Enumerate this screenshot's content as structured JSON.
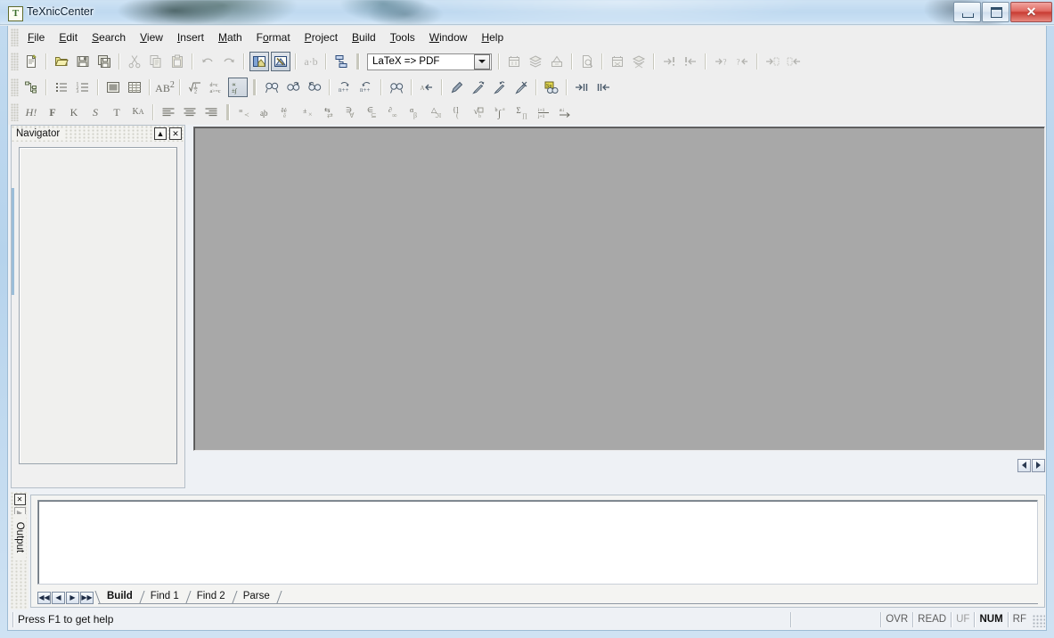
{
  "window": {
    "title": "TeXnicCenter",
    "app_icon": "T",
    "minimize_label": "Minimize",
    "maximize_label": "Maximize",
    "close_label": "Close",
    "close_glyph": "✕"
  },
  "menubar": {
    "items": [
      {
        "label": "File",
        "accel": "F"
      },
      {
        "label": "Edit",
        "accel": "E"
      },
      {
        "label": "Search",
        "accel": "S"
      },
      {
        "label": "View",
        "accel": "V"
      },
      {
        "label": "Insert",
        "accel": "I"
      },
      {
        "label": "Math",
        "accel": "M"
      },
      {
        "label": "Format",
        "accel": "o"
      },
      {
        "label": "Project",
        "accel": "P"
      },
      {
        "label": "Build",
        "accel": "B"
      },
      {
        "label": "Tools",
        "accel": "T"
      },
      {
        "label": "Window",
        "accel": "W"
      },
      {
        "label": "Help",
        "accel": "H"
      }
    ]
  },
  "toolbar_standard": {
    "profile_combo": {
      "value": "LaTeX => PDF",
      "placeholder": "LaTeX => PDF"
    },
    "buttons": [
      {
        "name": "new-document",
        "label": "New"
      },
      {
        "name": "open-document",
        "label": "Open"
      },
      {
        "name": "save-document",
        "label": "Save"
      },
      {
        "name": "save-all-documents",
        "label": "Save All"
      },
      {
        "name": "cut",
        "label": "Cut"
      },
      {
        "name": "copy",
        "label": "Copy"
      },
      {
        "name": "paste",
        "label": "Paste"
      },
      {
        "name": "undo",
        "label": "Undo"
      },
      {
        "name": "redo",
        "label": "Redo"
      },
      {
        "name": "toggle-navigator",
        "label": "Navigator",
        "pressed": true
      },
      {
        "name": "toggle-output",
        "label": "Output",
        "pressed": true
      },
      {
        "name": "toggle-whitespace",
        "label": "Show Whitespace"
      },
      {
        "name": "manage-projects",
        "label": "Project"
      },
      {
        "name": "build-current-file",
        "label": "Build Current File"
      },
      {
        "name": "build-output",
        "label": "Build Output"
      },
      {
        "name": "clean-output",
        "label": "Clean"
      },
      {
        "name": "view-output",
        "label": "View Output"
      },
      {
        "name": "stop-build",
        "label": "Stop"
      },
      {
        "name": "run-tool",
        "label": "Run Tool"
      },
      {
        "name": "next-error",
        "label": "Next Error"
      },
      {
        "name": "previous-error",
        "label": "Previous Error"
      },
      {
        "name": "next-warning",
        "label": "Next Warning"
      },
      {
        "name": "previous-warning",
        "label": "Previous Warning"
      },
      {
        "name": "next-bad-box",
        "label": "Next Bad Box"
      },
      {
        "name": "previous-bad-box",
        "label": "Previous Bad Box"
      }
    ]
  },
  "toolbar_latex": {
    "buttons": [
      {
        "name": "document-structure",
        "label": "Structure"
      },
      {
        "name": "itemize-list",
        "label": "Itemize"
      },
      {
        "name": "enumerate-list",
        "label": "Enumerate"
      },
      {
        "name": "insert-figure",
        "label": "Insert Figure"
      },
      {
        "name": "insert-table",
        "label": "Insert Table"
      },
      {
        "name": "text-superscript",
        "label": "Superscript"
      },
      {
        "name": "insert-fraction",
        "label": "Fraction"
      },
      {
        "name": "insert-equation",
        "label": "Equation"
      },
      {
        "name": "math-mode",
        "label": "Math Mode",
        "pressed": true
      },
      {
        "name": "find",
        "label": "Find"
      },
      {
        "name": "find-next",
        "label": "Find Next"
      },
      {
        "name": "find-previous",
        "label": "Find Previous"
      },
      {
        "name": "increment-search-forward",
        "label": "Incremental Search Forward"
      },
      {
        "name": "increment-search-backward",
        "label": "Incremental Search Backward"
      },
      {
        "name": "find-in-files",
        "label": "Find in Files"
      },
      {
        "name": "goto-line",
        "label": "Go To Line"
      },
      {
        "name": "bookmark-toggle",
        "label": "Toggle Bookmark"
      },
      {
        "name": "bookmark-next",
        "label": "Next Bookmark"
      },
      {
        "name": "bookmark-previous",
        "label": "Previous Bookmark"
      },
      {
        "name": "bookmark-clear-all",
        "label": "Clear All Bookmarks"
      },
      {
        "name": "spell-check",
        "label": "Spell Check"
      },
      {
        "name": "goto-next-match",
        "label": "Next Match"
      },
      {
        "name": "goto-previous-match",
        "label": "Previous Match"
      }
    ]
  },
  "toolbar_format": {
    "buttons": [
      {
        "name": "heading-style",
        "label": "H!"
      },
      {
        "name": "bold-style",
        "label": "F"
      },
      {
        "name": "italic-style",
        "label": "K"
      },
      {
        "name": "slanted-style",
        "label": "S"
      },
      {
        "name": "typewriter-style",
        "label": "T"
      },
      {
        "name": "smallcaps-style",
        "label": "KA"
      },
      {
        "name": "align-left",
        "label": "Align Left"
      },
      {
        "name": "align-center",
        "label": "Align Center"
      },
      {
        "name": "align-right",
        "label": "Align Right"
      },
      {
        "name": "symbol-relations",
        "label": "Relations"
      },
      {
        "name": "symbol-accents",
        "label": "Accents"
      },
      {
        "name": "symbol-diacritics",
        "label": "Diacritics"
      },
      {
        "name": "symbol-operators",
        "label": "Operators"
      },
      {
        "name": "symbol-arrows",
        "label": "Arrows"
      },
      {
        "name": "symbol-logic",
        "label": "Logic"
      },
      {
        "name": "symbol-sets",
        "label": "Sets"
      },
      {
        "name": "symbol-calculus",
        "label": "Calculus"
      },
      {
        "name": "symbol-greek",
        "label": "Greek"
      },
      {
        "name": "symbol-misc",
        "label": "Misc"
      },
      {
        "name": "symbol-delimiters",
        "label": "Delimiters"
      },
      {
        "name": "symbol-roots",
        "label": "Roots"
      },
      {
        "name": "symbol-integrals",
        "label": "Integrals"
      },
      {
        "name": "symbol-sums",
        "label": "Sums"
      },
      {
        "name": "symbol-matrices",
        "label": "Matrices"
      },
      {
        "name": "symbol-arrow-long",
        "label": "Long Arrows"
      }
    ]
  },
  "navigator": {
    "title": "Navigator",
    "collapse_glyph": "▲",
    "close_glyph": "✕",
    "content": ""
  },
  "editor": {
    "content": "",
    "scroll_left_glyph": "◀",
    "scroll_right_glyph": "▶"
  },
  "output": {
    "label": "Output",
    "close_glyph": "✕",
    "expand_glyph": "▶",
    "content": "",
    "nav_first_glyph": "◀◀",
    "nav_prev_glyph": "◀",
    "nav_next_glyph": "▶",
    "nav_last_glyph": "▶▶",
    "tabs": [
      {
        "label": "Build",
        "active": true
      },
      {
        "label": "Find 1",
        "active": false
      },
      {
        "label": "Find 2",
        "active": false
      },
      {
        "label": "Parse",
        "active": false
      }
    ]
  },
  "statusbar": {
    "message": "Press F1 to get help",
    "indicators": [
      {
        "label": "OVR",
        "state": "normal"
      },
      {
        "label": "READ",
        "state": "normal"
      },
      {
        "label": "UF",
        "state": "normal"
      },
      {
        "label": "NUM",
        "state": "active"
      },
      {
        "label": "RF",
        "state": "normal"
      }
    ]
  },
  "colors": {
    "accent": "#3b6e2a",
    "close_button": "#c83c33",
    "editor_background": "#a8a8a8",
    "chrome_background": "#eeeeee",
    "glass_title": "#bfd9f0"
  }
}
